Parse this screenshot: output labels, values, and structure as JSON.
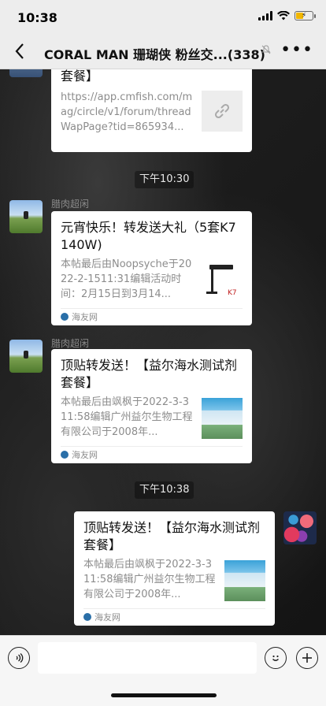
{
  "status_bar": {
    "time": "10:38"
  },
  "nav": {
    "back_icon": "chevron-left-icon",
    "title": "CORAL MAN 珊瑚侠 粉丝交...(338)",
    "mute_icon": "bell-slash-icon",
    "more_label": "•••"
  },
  "messages": {
    "first_card": {
      "title": "顶贴转发送！【益尔海水测试剂套餐】",
      "desc": "https://app.cmfish.com/mag/circle/v1/forum/threadWapPage?tid=865934...",
      "thumb_icon": "link-icon"
    },
    "time1": "下午10:30",
    "msg2": {
      "sender": "腊肉超闲",
      "title": "元宵快乐！转发送大礼（5套K7 140W)",
      "desc": "本帖最后由Noopsyche于2022-2-1511:31编辑活动时间：2月15日到3月14...",
      "source": "海友网",
      "thumb_text": "K7"
    },
    "msg3": {
      "sender": "腊肉超闲",
      "title": "顶贴转发送！【益尔海水测试剂套餐】",
      "desc": "本帖最后由飒枫于2022-3-311:58编辑广州益尔生物工程有限公司于2008年...",
      "source": "海友网"
    },
    "time2": "下午10:38",
    "msg4": {
      "title": "顶贴转发送！【益尔海水测试剂套餐】",
      "desc": "本帖最后由飒枫于2022-3-311:58编辑广州益尔生物工程有限公司于2008年...",
      "source": "海友网"
    }
  },
  "input_bar": {
    "voice_icon": "voice-icon",
    "emoji_icon": "emoji-icon",
    "plus_icon": "plus-icon",
    "placeholder": ""
  }
}
